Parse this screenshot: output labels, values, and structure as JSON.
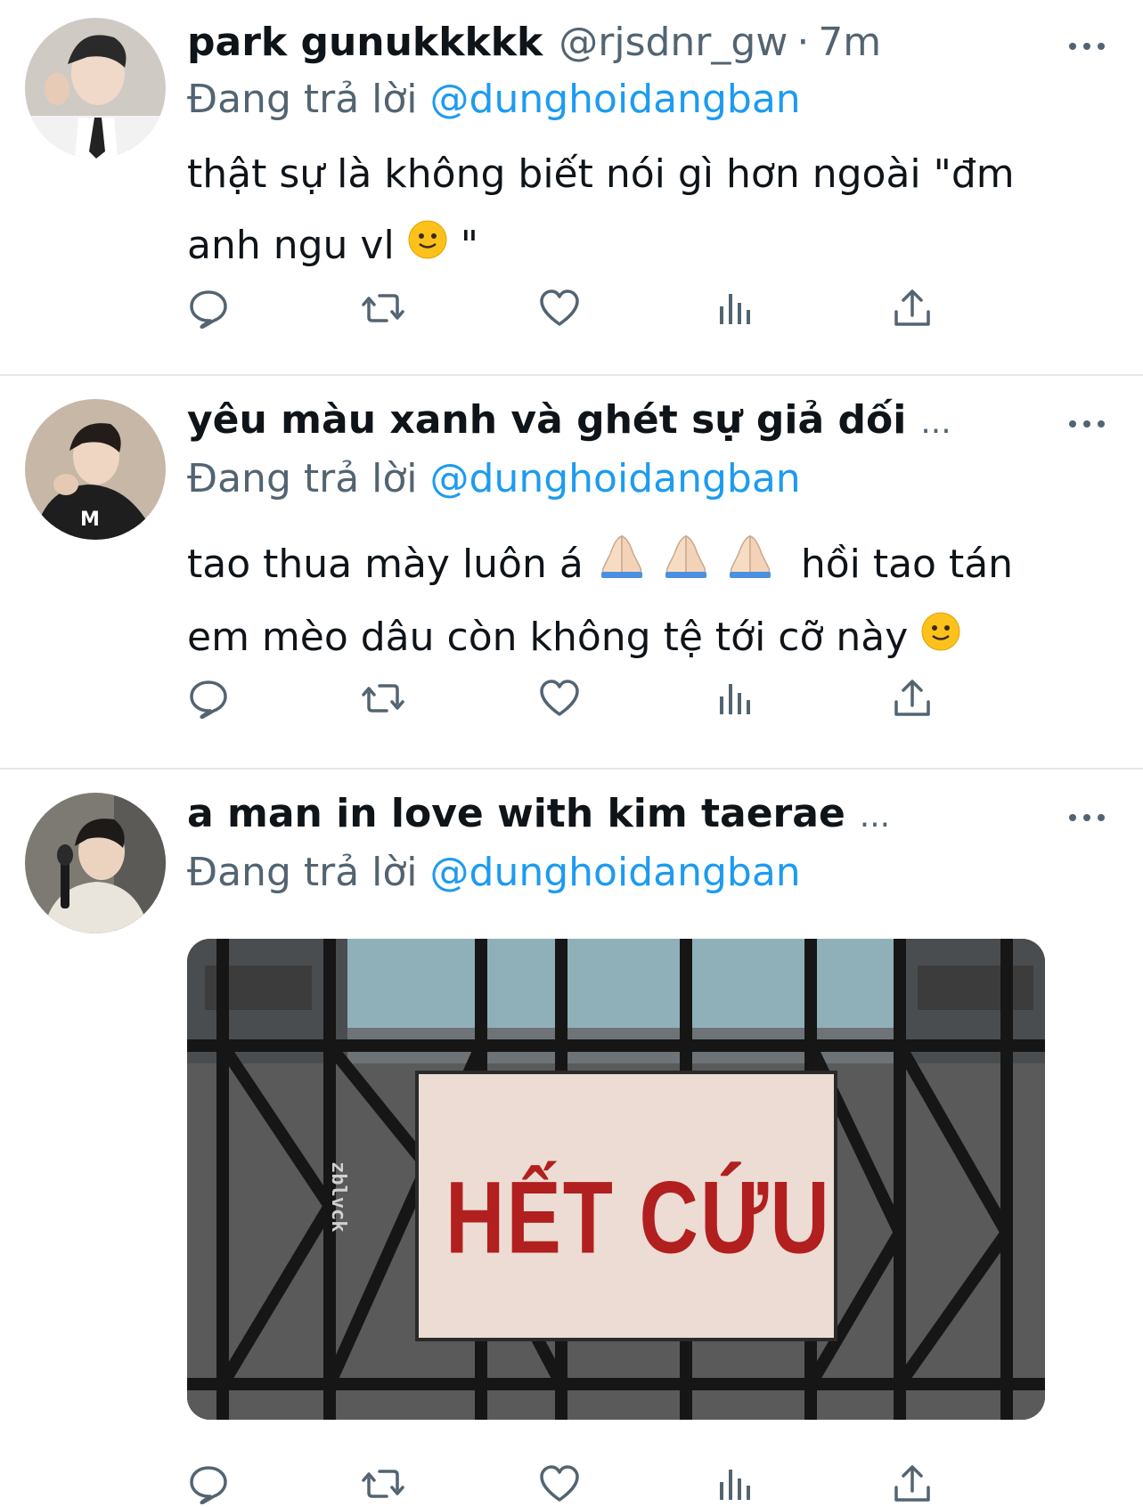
{
  "tweets": [
    {
      "name": "park gunukkkkk",
      "handle": "@rjsdnr_gw",
      "separator": "·",
      "time": "7m",
      "reply_prefix": "Đang trả lời",
      "reply_to": "@dunghoidangban",
      "lines": [
        "thật sự là không biết nói gì hơn ngoài \"đm",
        "anh ngu vl",
        "\""
      ],
      "emojis": [
        "slightly-smiling-face"
      ]
    },
    {
      "name": "yêu màu xanh và ghét sự giả dối",
      "name_ellipsis": "...",
      "reply_prefix": "Đang trả lời",
      "reply_to": "@dunghoidangban",
      "lines": [
        "tao thua mày luôn á",
        "hồi tao tán",
        "em mèo dâu còn không tệ tới cỡ này"
      ],
      "emojis": [
        "folded-hands",
        "folded-hands",
        "folded-hands",
        "slightly-smiling-face"
      ]
    },
    {
      "name": "a man in love with kim taerae",
      "name_ellipsis": "...",
      "reply_prefix": "Đang trả lời",
      "reply_to": "@dunghoidangban",
      "media": {
        "sign_text": "HẾT CỨU",
        "watermark": "zblvck"
      }
    }
  ],
  "icons": {
    "reply": "reply-icon",
    "retweet": "retweet-icon",
    "like": "like-icon",
    "views": "views-icon",
    "share": "share-icon",
    "more": "more-icon"
  },
  "colors": {
    "text": "#0f1419",
    "secondary": "#536471",
    "mention": "#1d9bf0",
    "divider": "#e6e6e6"
  }
}
